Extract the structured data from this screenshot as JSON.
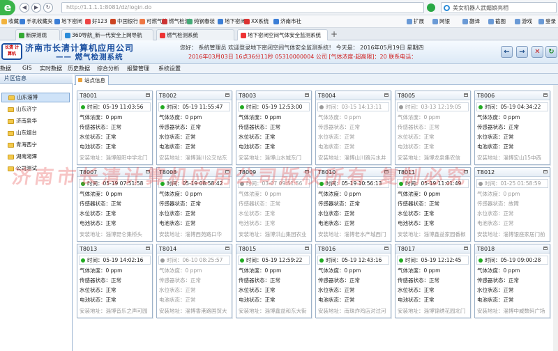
{
  "browser": {
    "url": "http://1.1.1.1:8081/dz/login.do",
    "search_text": "美女机器人武媚娘亮相",
    "favorites": [
      "收藏",
      "手机收藏夹",
      "地下密闭",
      "好123",
      "中国银行",
      "可燃气性",
      "燃气检测",
      "纯钢春装",
      "地下密闭",
      "XX系统",
      "济南市社"
    ],
    "toolbar_right": [
      "扩展",
      "网银",
      "翻译",
      "截图",
      "游戏",
      "登录"
    ],
    "tabs": [
      {
        "label": "新屏测观",
        "active": false
      },
      {
        "label": "360导航_新一代安全上网导航",
        "active": false
      },
      {
        "label": "燃气检测系统",
        "active": false
      },
      {
        "label": "地下密闭空间气体安全监测系统",
        "active": true
      }
    ]
  },
  "app": {
    "company": "济南市长清计算机应用公司",
    "subtitle": "—— 燃气检测系统",
    "logo_text": "长清 计算机",
    "info_line1": "您好： 系统管理员  欢迎登录地下密闭空间气体安全监测系统！  今天是： 2016年05月19日  星期四",
    "info_line2": "2016年03月03日 16点36分11秒 05310000004 公司 [气体浓度-超高限]：20 联系电话：",
    "header_buttons": [
      "←",
      "→",
      "✕",
      "↻"
    ]
  },
  "menu": [
    "数据",
    "GIS",
    "实时数据",
    "历史数据",
    "综合分析",
    "报警管理",
    "系统设置"
  ],
  "sidebar": {
    "title": "片区信息",
    "items": [
      {
        "label": "山东淄博",
        "selected": true
      },
      {
        "label": "山东济宁",
        "selected": false
      },
      {
        "label": "济南泉华",
        "selected": false
      },
      {
        "label": "山东烟台",
        "selected": false
      },
      {
        "label": "青海西宁",
        "selected": false
      },
      {
        "label": "湖南湘潭",
        "selected": false
      },
      {
        "label": "公司测试",
        "selected": false
      }
    ]
  },
  "content_tab": "站点信息",
  "labels": {
    "time": "时间：",
    "gas": "气体浓度：",
    "sensor": "传感器状态：",
    "water": "水位状态：",
    "battery": "电池状态：",
    "address": "安装地址："
  },
  "colors": {
    "online": "#22aa22",
    "offline": "#9a9a9a",
    "watermark": "#e05050"
  },
  "stations": [
    {
      "id": "T8001",
      "online": true,
      "time": "05-19 11:03:56",
      "gas": "0 ppm",
      "sensor": "正常",
      "water": "正常",
      "battery": "正常",
      "address": "淄博般阳中学北门"
    },
    {
      "id": "T8002",
      "online": true,
      "time": "05-19 11:55:47",
      "gas": "0 ppm",
      "sensor": "正常",
      "water": "正常",
      "battery": "正常",
      "address": "淄博淄川公交站东"
    },
    {
      "id": "T8003",
      "online": true,
      "time": "05-19 12:53:00",
      "gas": "0 ppm",
      "sensor": "正常",
      "water": "正常",
      "battery": "正常",
      "address": "淄博山水城东门"
    },
    {
      "id": "T8004",
      "online": false,
      "time": "03-15 14:13:11",
      "gas": "0 ppm",
      "sensor": "正常",
      "water": "正常",
      "battery": "正常",
      "address": "淄博山川路污水井"
    },
    {
      "id": "T8005",
      "online": false,
      "time": "03-13 12:19:05",
      "gas": "0 ppm",
      "sensor": "正常",
      "water": "正常",
      "battery": "正常",
      "address": "淄博龙泉集农信"
    },
    {
      "id": "T8006",
      "online": true,
      "time": "05-19 04:34:22",
      "gas": "0 ppm",
      "sensor": "正常",
      "water": "正常",
      "battery": "正常",
      "address": "淄博宏山15中西"
    },
    {
      "id": "T8007",
      "online": true,
      "time": "05-19 07:51:58",
      "gas": "0 ppm",
      "sensor": "正常",
      "water": "正常",
      "battery": "正常",
      "address": "淄博昆仑集桥头"
    },
    {
      "id": "T8008",
      "online": true,
      "time": "05-19 08:58:42",
      "gas": "0 ppm",
      "sensor": "正常",
      "water": "正常",
      "battery": "正常",
      "address": "淄博西苑路口华"
    },
    {
      "id": "T8009",
      "online": false,
      "time": "03-07 09:51:56",
      "gas": "0 ppm",
      "sensor": "正常",
      "water": "正常",
      "battery": "正常",
      "address": "淄博洪山集团农业"
    },
    {
      "id": "T8010",
      "online": true,
      "time": "05-19 10:56:13",
      "gas": "0 ppm",
      "sensor": "正常",
      "water": "正常",
      "battery": "正常",
      "address": "淄博老水产城西门"
    },
    {
      "id": "T8011",
      "online": true,
      "time": "05-19 11:01:49",
      "gas": "0 ppm",
      "sensor": "正常",
      "water": "正常",
      "battery": "正常",
      "address": "淄博鑫益家园番椒"
    },
    {
      "id": "T8012",
      "online": false,
      "time": "01-25 01:58:59",
      "gas": "0 ppm",
      "sensor": "故障",
      "water": "正常",
      "battery": "正常",
      "address": "淄博银座家居门前"
    },
    {
      "id": "T8013",
      "online": true,
      "time": "05-19 14:02:16",
      "gas": "0 ppm",
      "sensor": "正常",
      "water": "正常",
      "battery": "正常",
      "address": "淄博音乐之声可园"
    },
    {
      "id": "T8014",
      "online": false,
      "time": "06-10 08:25:57",
      "gas": "0 ppm",
      "sensor": "正常",
      "water": "正常",
      "battery": "正常",
      "address": "淄博香港路国贸大"
    },
    {
      "id": "T8015",
      "online": true,
      "time": "05-19 12:59:22",
      "gas": "0 ppm",
      "sensor": "正常",
      "water": "正常",
      "battery": "正常",
      "address": "淄博鑫益和东大街"
    },
    {
      "id": "T8016",
      "online": true,
      "time": "05-19 12:43:16",
      "gas": "0 ppm",
      "sensor": "正常",
      "water": "正常",
      "battery": "正常",
      "address": "南珠炸鸡店对过河"
    },
    {
      "id": "T8017",
      "online": true,
      "time": "05-19 12:12:45",
      "gas": "0 ppm",
      "sensor": "正常",
      "water": "正常",
      "battery": "正常",
      "address": "淄博锦绣花园北门"
    },
    {
      "id": "T8018",
      "online": true,
      "time": "05-19 09:00:28",
      "gas": "0 ppm",
      "sensor": "正常",
      "water": "正常",
      "battery": "正常",
      "address": "淄博中威数码广场"
    }
  ],
  "watermark": "济南市长清计算机应用公司版权所有 复制必究"
}
